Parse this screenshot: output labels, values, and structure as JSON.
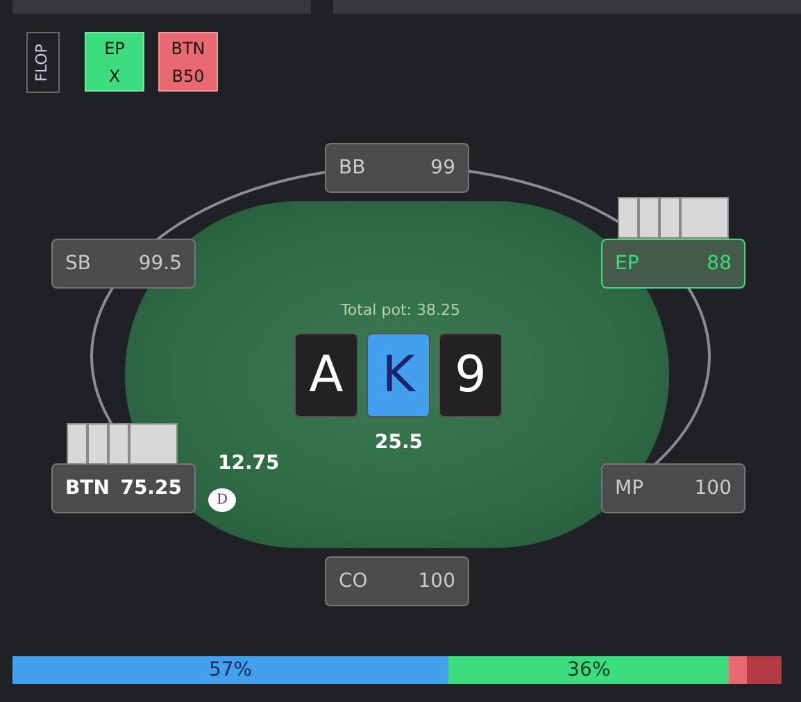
{
  "top_panels": [
    {
      "kind": "panel"
    },
    {
      "kind": "panel"
    }
  ],
  "history": [
    {
      "kind": "street",
      "label": "FLOP"
    },
    {
      "kind": "action",
      "position": "EP",
      "action": "X",
      "color": "#3ddc7f"
    },
    {
      "kind": "action",
      "position": "BTN",
      "action": "B50",
      "color": "#e8696f"
    }
  ],
  "seats": [
    {
      "position": "BB",
      "stack": "99",
      "acting": false,
      "hero": false
    },
    {
      "position": "SB",
      "stack": "99.5",
      "acting": false,
      "hero": false
    },
    {
      "position": "EP",
      "stack": "88",
      "acting": true,
      "hero": false,
      "has_cards": true
    },
    {
      "position": "BTN",
      "stack": "75.25",
      "acting": false,
      "hero": true,
      "has_cards": true,
      "dealer": true,
      "bet": "12.75",
      "dealer_label": "D"
    },
    {
      "position": "MP",
      "stack": "100",
      "acting": false,
      "hero": false
    },
    {
      "position": "CO",
      "stack": "100",
      "acting": false,
      "hero": false
    }
  ],
  "pot": {
    "label": "Total pot: 38.25",
    "amount": "25.5"
  },
  "board": [
    {
      "rank": "A",
      "color": "#222222"
    },
    {
      "rank": "K",
      "color": "#42a0ec"
    },
    {
      "rank": "9",
      "color": "#222222"
    }
  ],
  "equity": [
    {
      "label": "57%",
      "color": "#42a0ec"
    },
    {
      "label": "36%",
      "color": "#3ddc7f"
    },
    {
      "color": "#e8696f"
    },
    {
      "color": "#b33a42"
    }
  ]
}
